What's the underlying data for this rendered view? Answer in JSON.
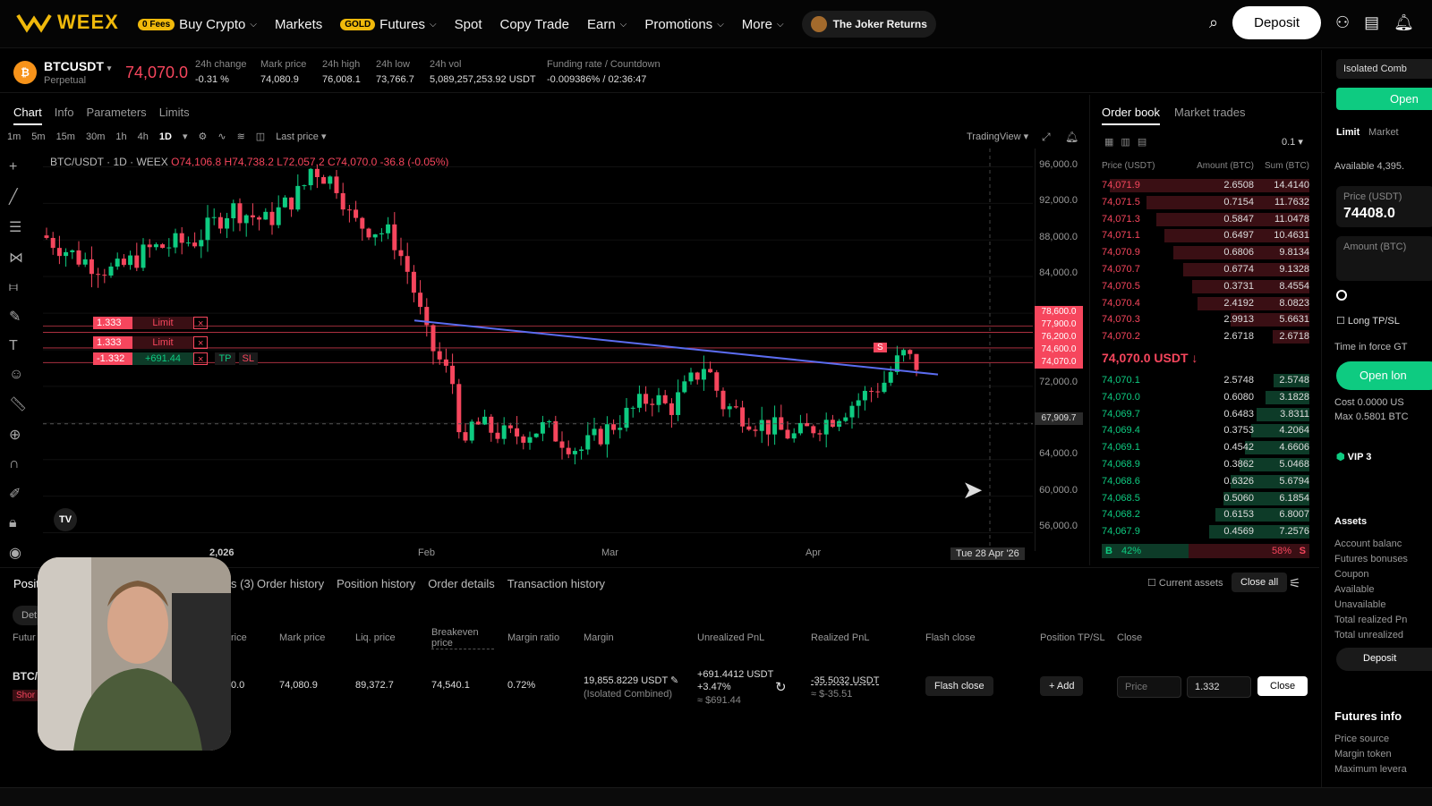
{
  "nav": {
    "logo": "WEEX",
    "items": [
      {
        "label": "Buy Crypto",
        "tag": "0 Fees",
        "dropdown": true
      },
      {
        "label": "Markets"
      },
      {
        "label": "Futures",
        "tag": "GOLD",
        "dropdown": true
      },
      {
        "label": "Spot"
      },
      {
        "label": "Copy Trade"
      },
      {
        "label": "Earn",
        "dropdown": true
      },
      {
        "label": "Promotions",
        "dropdown": true
      },
      {
        "label": "More",
        "dropdown": true
      }
    ],
    "promo": "The Joker Returns",
    "deposit": "Deposit"
  },
  "ticker": {
    "symbol": "BTCUSDT",
    "type": "Perpetual",
    "price": "74,070.0",
    "stats": [
      {
        "label": "24h change",
        "value": "-0.31 %"
      },
      {
        "label": "Mark price",
        "value": "74,080.9"
      },
      {
        "label": "24h high",
        "value": "76,008.1"
      },
      {
        "label": "24h low",
        "value": "73,766.7"
      },
      {
        "label": "24h vol",
        "value": "5,089,257,253.92 USDT"
      },
      {
        "label": "Funding rate / Countdown",
        "value": "-0.009386% / 02:36:47"
      }
    ]
  },
  "chart": {
    "tabs": [
      "Chart",
      "Info",
      "Parameters",
      "Limits"
    ],
    "timeframes": [
      "1m",
      "5m",
      "15m",
      "30m",
      "1h",
      "4h",
      "1D"
    ],
    "price_type": "Last price",
    "provider": "TradingView",
    "title": "BTC/USDT · 1D · WEEX",
    "ohlc": "O74,106.8 H74,738.2 L72,057.2 C74,070.0 -36.8 (-0.05%)",
    "y_ticks": [
      "96,000.0",
      "92,000.0",
      "88,000.0",
      "84,000.0",
      "72,000.0",
      "64,000.0",
      "60,000.0",
      "56,000.0"
    ],
    "price_labels": [
      "78,600.0",
      "77,900.0",
      "76,200.0",
      "74,600.0",
      "74,070.0"
    ],
    "crosshair_price": "67,909.7",
    "x_ticks": [
      "2,026",
      "Feb",
      "Mar",
      "Apr"
    ],
    "crosshair_date": "Tue 28 Apr '26",
    "orders": [
      {
        "qty": "1.333",
        "label": "Limit"
      },
      {
        "qty": "1.333",
        "label": "Limit"
      },
      {
        "qty": "-1.332",
        "label": "+691.44",
        "tp": "TP",
        "sl": "SL"
      }
    ],
    "marker": "S"
  },
  "orderbook": {
    "tabs": [
      "Order book",
      "Market trades"
    ],
    "step": "0.1",
    "headers": [
      "Price (USDT)",
      "Amount (BTC)",
      "Sum (BTC)"
    ],
    "asks": [
      [
        "74,071.9",
        "2.6508",
        "14.4140"
      ],
      [
        "74,071.5",
        "0.7154",
        "11.7632"
      ],
      [
        "74,071.3",
        "0.5847",
        "11.0478"
      ],
      [
        "74,071.1",
        "0.6497",
        "10.4631"
      ],
      [
        "74,070.9",
        "0.6806",
        "9.8134"
      ],
      [
        "74,070.7",
        "0.6774",
        "9.1328"
      ],
      [
        "74,070.5",
        "0.3731",
        "8.4554"
      ],
      [
        "74,070.4",
        "2.4192",
        "8.0823"
      ],
      [
        "74,070.3",
        "2.9913",
        "5.6631"
      ],
      [
        "74,070.2",
        "2.6718",
        "2.6718"
      ]
    ],
    "mid": "74,070.0 USDT",
    "bids": [
      [
        "74,070.1",
        "2.5748",
        "2.5748"
      ],
      [
        "74,070.0",
        "0.6080",
        "3.1828"
      ],
      [
        "74,069.7",
        "0.6483",
        "3.8311"
      ],
      [
        "74,069.4",
        "0.3753",
        "4.2064"
      ],
      [
        "74,069.1",
        "0.4542",
        "4.6606"
      ],
      [
        "74,068.9",
        "0.3862",
        "5.0468"
      ],
      [
        "74,068.6",
        "0.6326",
        "5.6794"
      ],
      [
        "74,068.5",
        "0.5060",
        "6.1854"
      ],
      [
        "74,068.2",
        "0.6153",
        "6.8007"
      ],
      [
        "74,067.9",
        "0.4569",
        "7.2576"
      ]
    ],
    "buy_label": "B",
    "buy_pct": "42%",
    "sell_pct": "58%",
    "sell_label": "S"
  },
  "trade": {
    "mode": "Isolated Comb",
    "open": "Open",
    "order_types": [
      "Limit",
      "Market"
    ],
    "available": "Available 4,395.",
    "price_label": "Price (USDT)",
    "price_value": "74408.0",
    "amount_label": "Amount (BTC)",
    "tpsl": "Long TP/SL",
    "tif": "Time in force GT",
    "open_long": "Open lon",
    "cost": "Cost 0.0000 US",
    "max": "Max 0.5801 BTC",
    "vip": "VIP 3",
    "assets_title": "Assets",
    "assets": [
      "Account balanc",
      "Futures bonuses",
      "Coupon",
      "Available",
      "Unavailable",
      "Total realized Pn",
      "Total unrealized"
    ],
    "deposit": "Deposit",
    "futures_title": "Futures info",
    "futures": [
      "Price source",
      "Margin token",
      "Maximum levera"
    ]
  },
  "bottom": {
    "tab_first": "Positi",
    "tab_count": "s (3)",
    "tabs": [
      "Order history",
      "Position history",
      "Order details",
      "Transaction history"
    ],
    "current_assets": "Current assets",
    "close_all": "Close all",
    "filter": "Det",
    "headers": [
      "Futur",
      "rice",
      "Mark price",
      "Liq. price",
      "Breakeven price",
      "Margin ratio",
      "Margin",
      "Unrealized PnL",
      "Realized PnL",
      "Flash close",
      "Position TP/SL",
      "Close"
    ],
    "row": {
      "symbol": "BTC/",
      "side": "Shor",
      "entry": "0.0",
      "mark": "74,080.9",
      "liq": "89,372.7",
      "breakeven": "74,540.1",
      "ratio": "0.72%",
      "margin": "19,855.8229 USDT",
      "margin_sub": "(Isolated Combined)",
      "upnl": "+691.4412 USDT",
      "upnl_pct": "+3.47%",
      "upnl_usd": "≈ $691.44",
      "rpnl": "-35.5032 USDT",
      "rpnl_usd": "≈ $-35.51",
      "flash": "Flash close",
      "add": "+ Add",
      "price_placeholder": "Price",
      "qty": "1.332",
      "close": "Close"
    }
  }
}
